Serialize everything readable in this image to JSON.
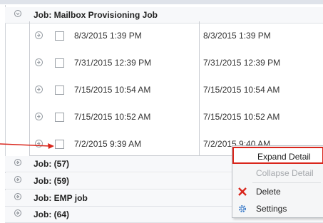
{
  "groups": [
    {
      "title": "Job: Mailbox Provisioning Job"
    },
    {
      "title": "Job: (57)"
    },
    {
      "title": "Job: (59)"
    },
    {
      "title": "Job: EMP job"
    },
    {
      "title": "Job: (64)"
    }
  ],
  "detail_rows": [
    {
      "col1": "8/3/2015 1:39 PM",
      "col2": "8/3/2015 1:39 PM"
    },
    {
      "col1": "7/31/2015 12:39 PM",
      "col2": "7/31/2015 12:39 PM"
    },
    {
      "col1": "7/15/2015 10:54 AM",
      "col2": "7/15/2015 10:54 AM"
    },
    {
      "col1": "7/15/2015 10:52 AM",
      "col2": "7/15/2015 10:52 AM"
    },
    {
      "col1": "7/2/2015 9:39 AM",
      "col2": "7/2/2015 9:40 AM"
    }
  ],
  "context_menu": {
    "items": [
      {
        "label": "Expand Detail",
        "icon": "none",
        "state": "highlighted"
      },
      {
        "label": "Collapse Detail",
        "icon": "none",
        "state": "disabled"
      },
      {
        "label": "Delete",
        "icon": "red-x-icon",
        "state": "enabled"
      },
      {
        "label": "Settings",
        "icon": "gear-icon",
        "state": "enabled"
      }
    ]
  },
  "colors": {
    "annotation": "#d9261c",
    "group_background": "#f7f8fa",
    "grid_line": "#c9ccd1"
  }
}
